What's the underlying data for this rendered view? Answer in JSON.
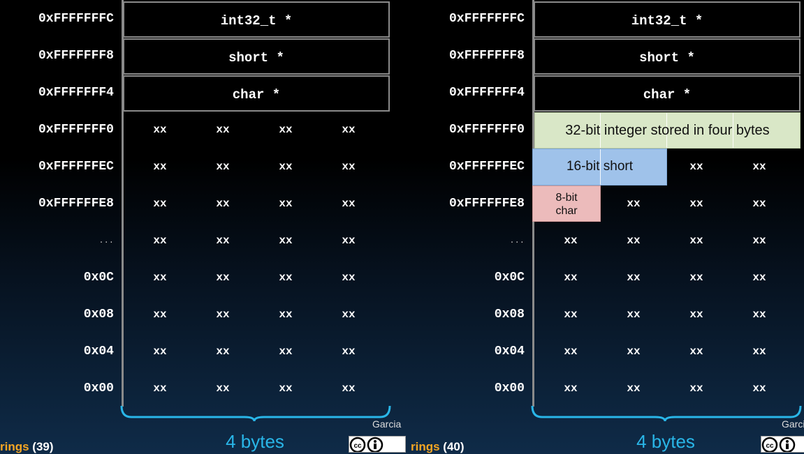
{
  "colors": {
    "accent": "#29b6e8",
    "title_orange": "#f5a623",
    "int_fill": "#d9e7c7",
    "short_fill": "#9fc2ea",
    "char_fill": "#ecbbbb"
  },
  "panels": [
    {
      "addresses": [
        "0xFFFFFFFC",
        "0xFFFFFFF8",
        "0xFFFFFFF4",
        "0xFFFFFFF0",
        "0xFFFFFFEC",
        "0xFFFFFFE8",
        "...",
        "0x0C",
        "0x08",
        "0x04",
        "0x00"
      ],
      "pointers": [
        "int32_t *",
        "short *",
        "char *"
      ],
      "cell_text": "xx",
      "bytes_label": "4 bytes",
      "footer_title": "rings",
      "footer_num": "(39)",
      "author": "Garcia",
      "icons": [
        "cc-icon",
        "by-icon"
      ]
    },
    {
      "addresses": [
        "0xFFFFFFFC",
        "0xFFFFFFF8",
        "0xFFFFFFF4",
        "0xFFFFFFF0",
        "0xFFFFFFEC",
        "0xFFFFFFE8",
        "...",
        "0x0C",
        "0x08",
        "0x04",
        "0x00"
      ],
      "pointers": [
        "int32_t *",
        "short *",
        "char *"
      ],
      "cell_text": "xx",
      "overlays": {
        "int": "32-bit integer stored in four bytes",
        "short": "16-bit short",
        "char_line1": "8-bit",
        "char_line2": "char"
      },
      "bytes_label": "4 bytes",
      "footer_title": "rings",
      "footer_num": "(40)",
      "author": "Garcia",
      "icons": [
        "cc-icon",
        "by-icon"
      ]
    }
  ]
}
